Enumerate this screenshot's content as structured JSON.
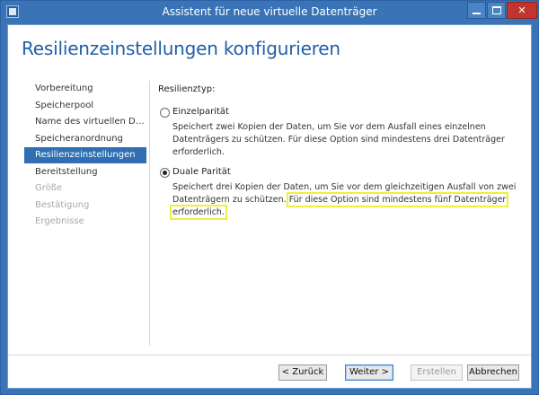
{
  "window": {
    "title": "Assistent für neue virtuelle Datenträger",
    "controls": {
      "minimize": "",
      "maximize": "",
      "close": "✕"
    }
  },
  "page": {
    "title": "Resilienzeinstellungen konfigurieren"
  },
  "nav": {
    "items": [
      {
        "label": "Vorbereitung",
        "state": "normal"
      },
      {
        "label": "Speicherpool",
        "state": "normal"
      },
      {
        "label": "Name des virtuellen Date...",
        "state": "normal"
      },
      {
        "label": "Speicheranordnung",
        "state": "normal"
      },
      {
        "label": "Resilienzeinstellungen",
        "state": "active"
      },
      {
        "label": "Bereitstellung",
        "state": "normal"
      },
      {
        "label": "Größe",
        "state": "disabled"
      },
      {
        "label": "Bestätigung",
        "state": "disabled"
      },
      {
        "label": "Ergebnisse",
        "state": "disabled"
      }
    ]
  },
  "content": {
    "section_label": "Resilienztyp:",
    "options": [
      {
        "label": "Einzelparität",
        "checked": false,
        "description": "Speichert zwei Kopien der Daten, um Sie vor dem Ausfall eines einzelnen Datenträgers zu schützen. Für diese Option sind mindestens drei Datenträger erforderlich.",
        "description_highlight": ""
      },
      {
        "label": "Duale Parität",
        "checked": true,
        "description": "Speichert drei Kopien der Daten, um Sie vor dem gleichzeitigen Ausfall von zwei Datenträgern zu schützen.",
        "description_highlight": "Für diese Option sind mindestens fünf Datenträger erforderlich."
      }
    ]
  },
  "buttons": {
    "back": "< Zurück",
    "next": "Weiter >",
    "finish": "Erstellen",
    "cancel": "Abbrechen"
  },
  "colors": {
    "title_bar": "#3a73b6",
    "accent": "#2f6fb2",
    "page_title": "#1f5fa6",
    "highlight_box": "#f0ef39",
    "close_button": "#c2352f"
  }
}
